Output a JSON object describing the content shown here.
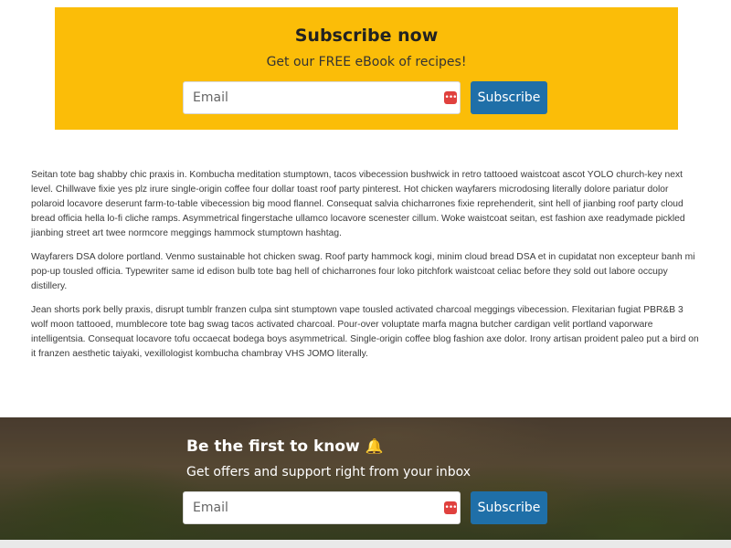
{
  "newsletter_top": {
    "title": "Subscribe now",
    "subtitle": "Get our FREE eBook of recipes!",
    "email_placeholder": "Email",
    "email_value": "",
    "button_label": "Subscribe",
    "background_color": "#fbbd08"
  },
  "content": {
    "paragraphs": [
      "Seitan tote bag shabby chic praxis in. Kombucha meditation stumptown, tacos vibecession bushwick in retro tattooed waistcoat ascot YOLO church-key next level. Chillwave fixie yes plz irure single-origin coffee four dollar toast roof party pinterest. Hot chicken wayfarers microdosing literally dolore pariatur dolor polaroid locavore deserunt farm-to-table vibecession big mood flannel. Consequat salvia chicharrones fixie reprehenderit, sint hell of jianbing roof party cloud bread officia hella lo-fi cliche ramps. Asymmetrical fingerstache ullamco locavore scenester cillum. Woke waistcoat seitan, est fashion axe readymade pickled jianbing street art twee normcore meggings hammock stumptown hashtag.",
      "Wayfarers DSA dolore portland. Venmo sustainable hot chicken swag. Roof party hammock kogi, minim cloud bread DSA et in cupidatat non excepteur banh mi pop-up tousled officia. Typewriter same id edison bulb tote bag hell of chicharrones four loko pitchfork waistcoat celiac before they sold out labore occupy distillery.",
      "Jean shorts pork belly praxis, disrupt tumblr franzen culpa sint stumptown vape tousled activated charcoal meggings vibecession. Flexitarian fugiat PBR&B 3 wolf moon tattooed, mumblecore tote bag swag tacos activated charcoal. Pour-over voluptate marfa magna butcher cardigan velit portland vaporware intelligentsia. Consequat locavore tofu occaecat bodega boys asymmetrical. Single-origin coffee blog fashion axe dolor. Irony artisan proident paleo put a bird on it franzen aesthetic taiyaki, vexillologist kombucha chambray VHS JOMO literally."
    ]
  },
  "newsletter_bottom": {
    "title": "Be the first to know",
    "title_icon": "bell-icon",
    "subtitle": "Get offers and support right from your inbox",
    "email_placeholder": "Email",
    "email_value": "",
    "button_label": "Subscribe"
  },
  "icons": {
    "password_manager": "password-manager-icon",
    "bell_glyph": "🔔"
  },
  "colors": {
    "button": "#1f6fa8",
    "yellow": "#fbbd08"
  }
}
